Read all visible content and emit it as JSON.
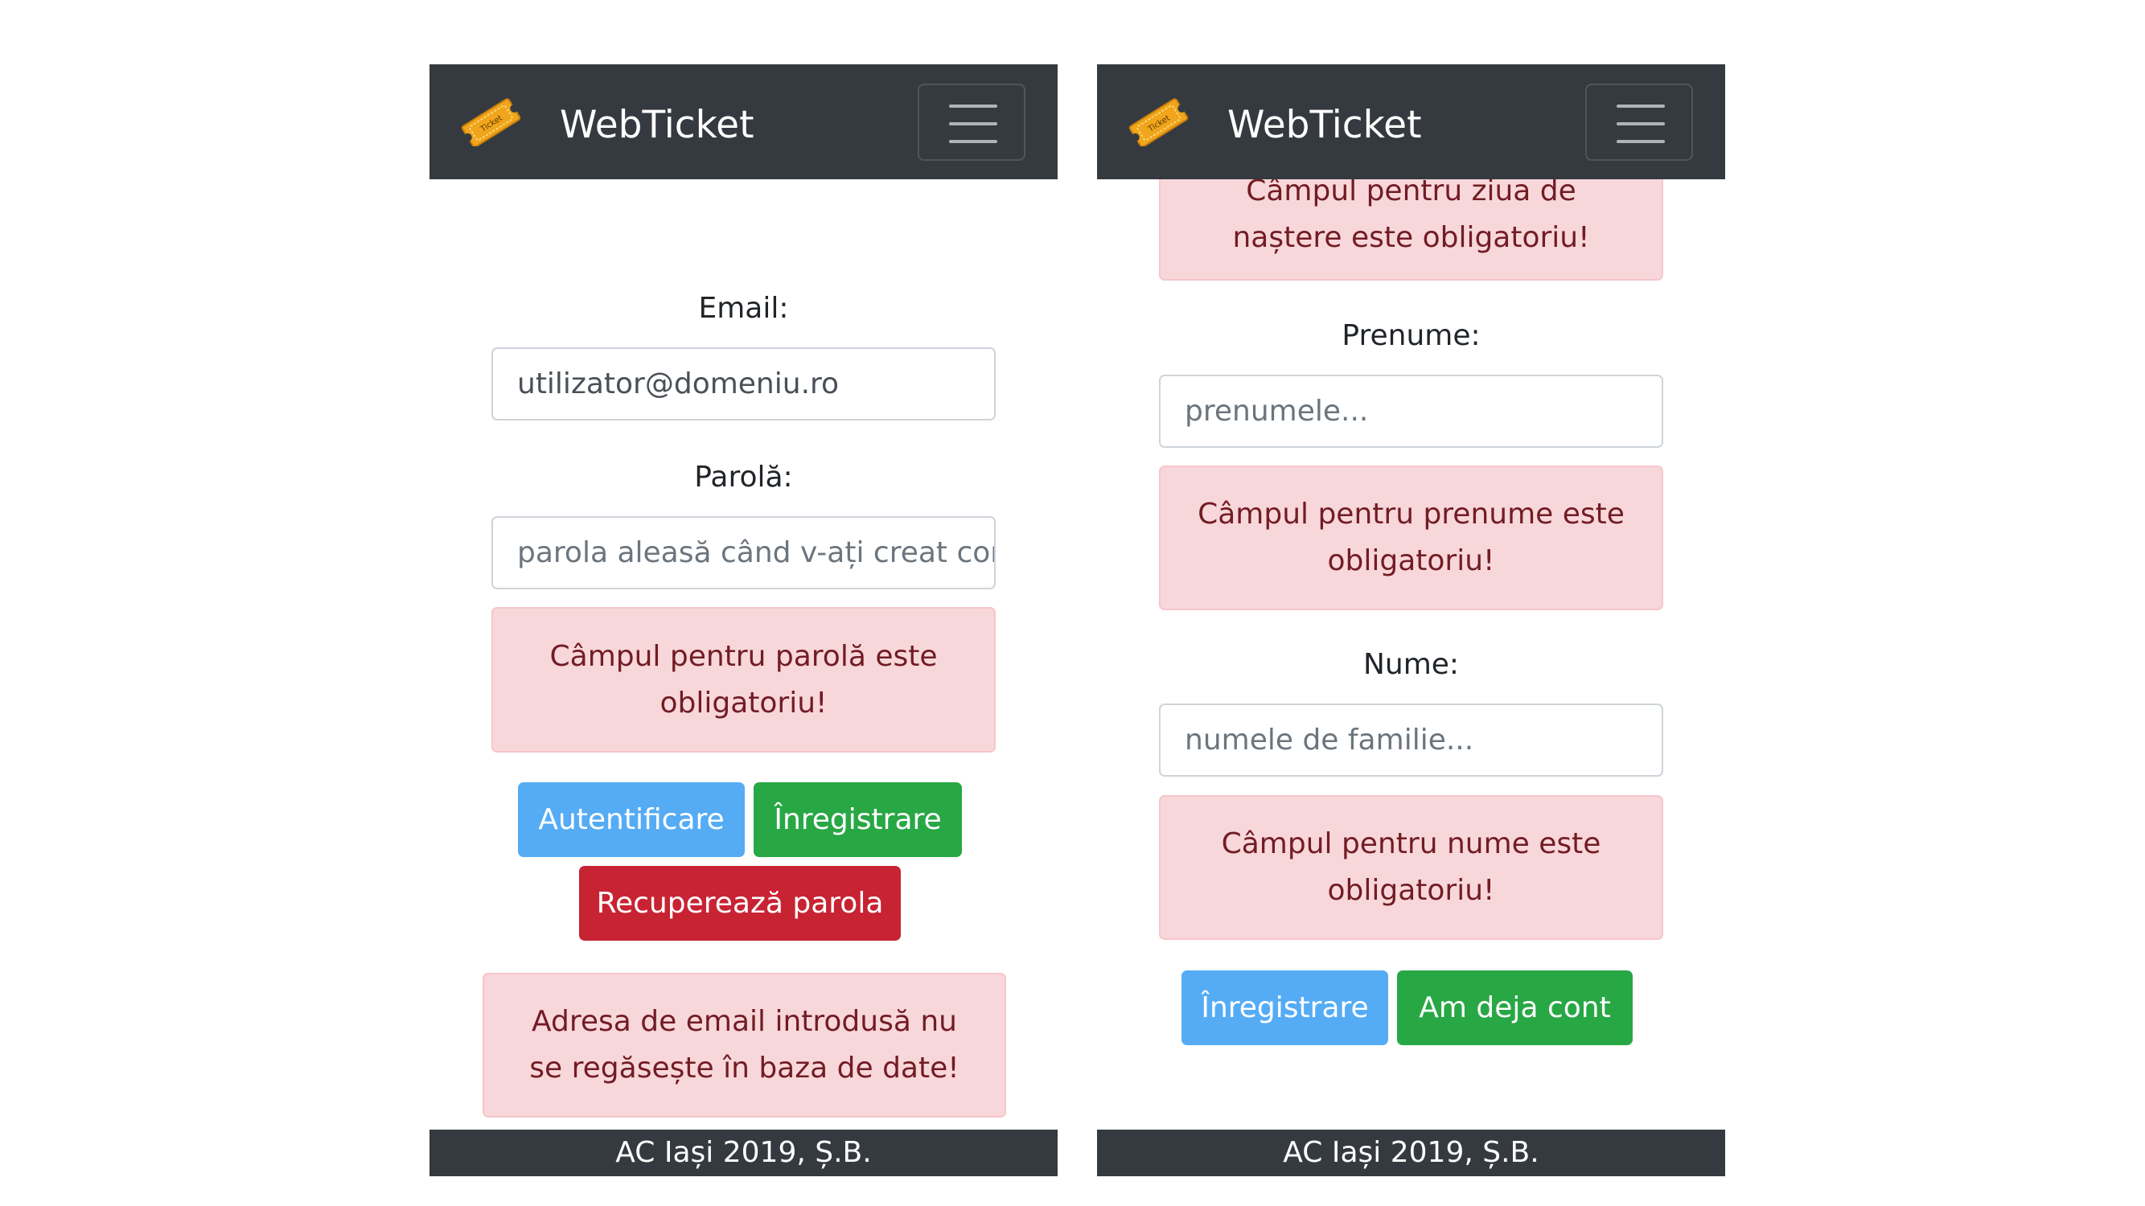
{
  "colors": {
    "navbar": "#343a40",
    "alert_bg": "#f8d7da",
    "alert_text": "#721c24",
    "primary": "#55acf5",
    "success": "#28a745",
    "danger": "#c82333"
  },
  "brand": {
    "name": "WebTicket",
    "logo_text": "Ticket",
    "logo_icon": "ticket-icon",
    "menu_icon": "hamburger-menu-icon"
  },
  "login": {
    "email_label": "Email:",
    "email_value": "utilizator@domeniu.ro",
    "password_label": "Parolă:",
    "password_placeholder": "parola aleasă când v-ați creat cor",
    "password_error": "Câmpul pentru parolă este obligatoriu!",
    "login_button": "Autentificare",
    "register_button": "Înregistrare",
    "recover_button": "Recuperează parola",
    "email_error": "Adresa de email introdusă nu se regăsește în baza de date!"
  },
  "register": {
    "birthday_error": "Câmpul pentru ziua de naștere este obligatoriu!",
    "firstname_label": "Prenume:",
    "firstname_placeholder": "prenumele...",
    "firstname_error": "Câmpul pentru prenume este obligatoriu!",
    "lastname_label": "Nume:",
    "lastname_placeholder": "numele de familie...",
    "lastname_error": "Câmpul pentru nume este obligatoriu!",
    "register_button": "Înregistrare",
    "have_account_button": "Am deja cont"
  },
  "footer": {
    "text": "AC Iași 2019, Ș.B."
  }
}
